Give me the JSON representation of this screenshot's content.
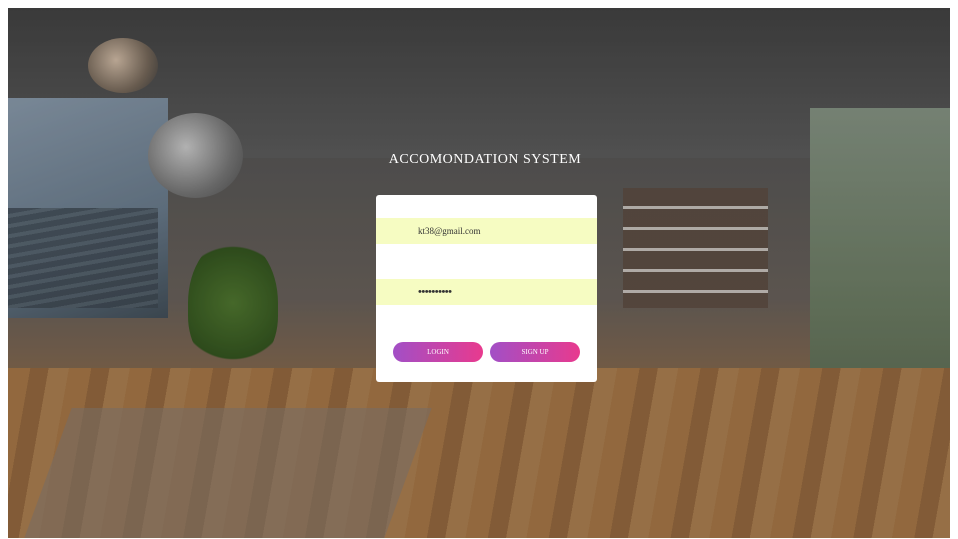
{
  "app": {
    "title": "ACCOMONDATION SYSTEM"
  },
  "login_form": {
    "username_value": "kt38@gmail.com",
    "password_value": "••••••••••",
    "login_label": "LOGIN",
    "signup_label": "SIGN UP"
  },
  "colors": {
    "field_background": "#f6fcc2",
    "button_gradient_start": "#a24fc6",
    "button_gradient_end": "#e83a8e",
    "card_background": "#ffffff"
  }
}
